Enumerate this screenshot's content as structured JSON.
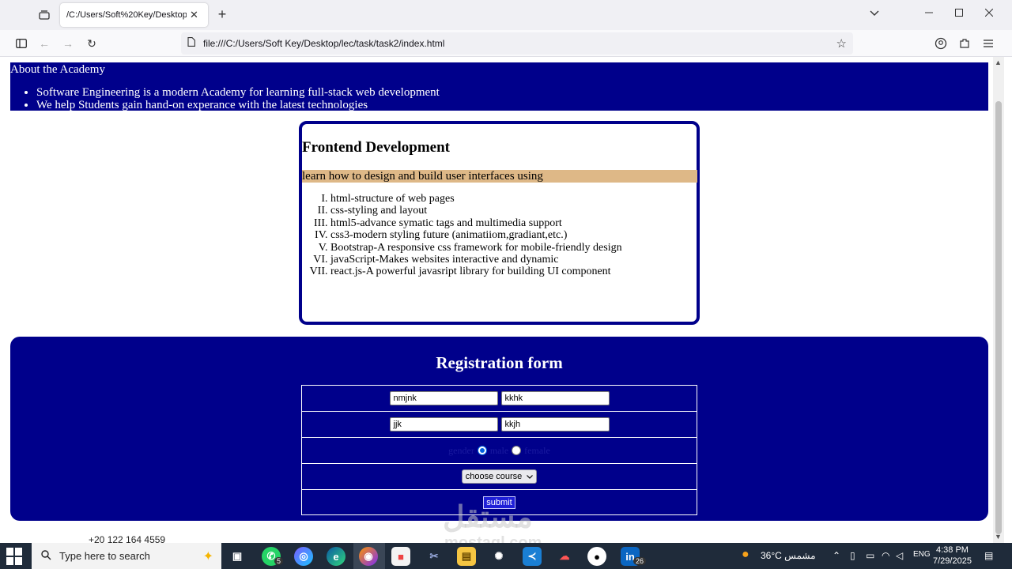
{
  "browser": {
    "tab_title": "/C:/Users/Soft%20Key/Desktop/lec/",
    "tab_close": "✕",
    "new_tab": "+",
    "url": "file:///C:/Users/Soft Key/Desktop/lec/task/task2/index.html"
  },
  "about": {
    "title": "About the Academy",
    "items": [
      "Software Engineering is a modern Academy for learning full-stack web development",
      "We help Students gain hand-on experance with the latest technologies"
    ]
  },
  "frontend": {
    "title": "Frontend Development",
    "intro": "learn how to design and build user interfaces using",
    "topics": [
      "html-structure of web pages",
      "css-styling and layout",
      "html5-advance symatic tags and multimedia support",
      "css3-modern styling future (animatiiom,gradiant,etc.)",
      "Bootstrap-A responsive css framework for mobile-friendly design",
      "javaScript-Makes websites interactive and dynamic",
      "react.js-A powerful javasript library for building UI component"
    ]
  },
  "registration": {
    "title": "Registration form",
    "first_name": "nmjnk",
    "last_name": "kkhk",
    "field3": "jjk",
    "field4": "kkjh",
    "gender_label": "gender",
    "male_label": "male",
    "female_label": "female",
    "gender_selected": "male",
    "course_select": "choose course",
    "submit_label": "submit"
  },
  "below_text": "+20 122 164 4559",
  "watermark": {
    "main": "مستقل",
    "sub": "mostaql.com"
  },
  "taskbar": {
    "search_placeholder": "Type here to search",
    "whatsapp_badge": "5",
    "linkedin_badge": "26",
    "weather": "36°C مشمس",
    "language": "ENG",
    "time": "4:38 PM",
    "date": "7/29/2025"
  },
  "colors": {
    "navy": "#00008b",
    "band": "#deb887",
    "taskbar": "#1f2b3a"
  }
}
